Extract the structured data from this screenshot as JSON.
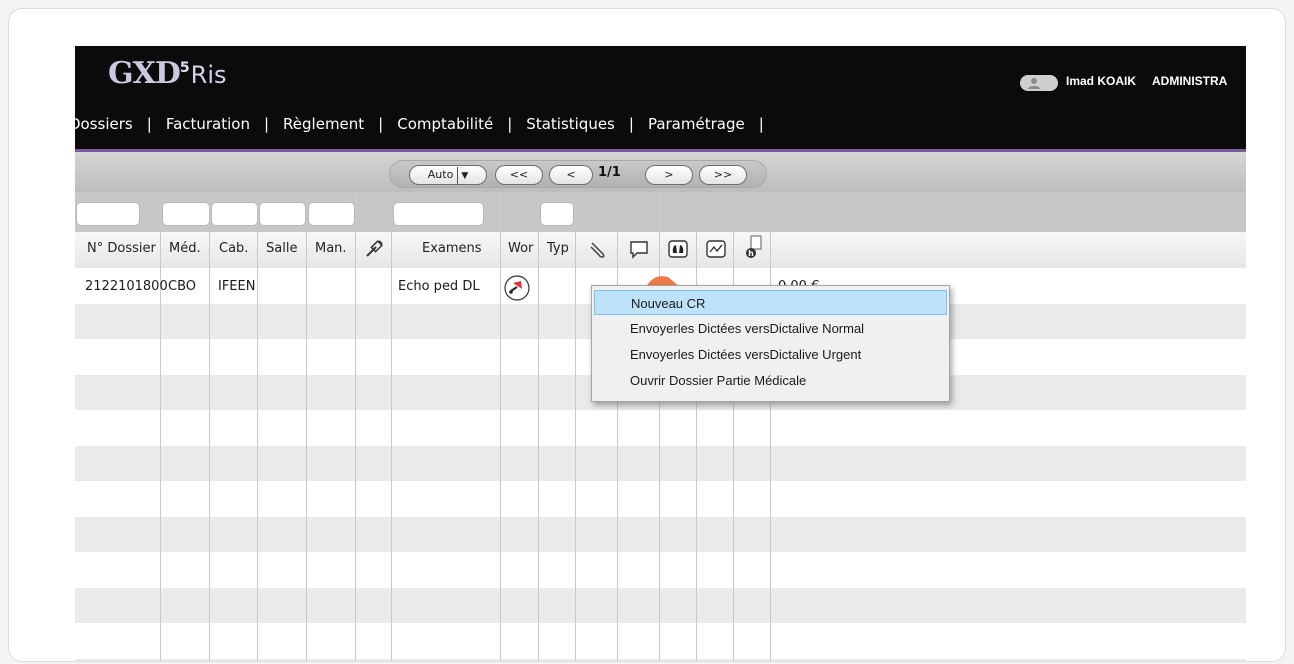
{
  "app": {
    "logo_main": "GXD",
    "logo_sup": "5",
    "logo_suffix": "Ris",
    "user_name": "Imad KOAIK",
    "user_role": "ADMINISTRA"
  },
  "nav": {
    "items": [
      {
        "label": "Dossiers"
      },
      {
        "label": "Facturation"
      },
      {
        "label": "Règlement"
      },
      {
        "label": "Comptabilité"
      },
      {
        "label": "Statistiques"
      },
      {
        "label": "Paramétrage"
      }
    ],
    "separator": "|"
  },
  "pager": {
    "mode": "Auto",
    "first": "<<",
    "prev": "<",
    "page_info": "1/1",
    "next": ">",
    "last": ">>"
  },
  "columns": {
    "dossier": "N° Dossier",
    "med": "Méd.",
    "cab": "Cab.",
    "salle": "Salle",
    "man": "Man.",
    "examens": "Examens",
    "wor": "Wor",
    "typ": "Typ"
  },
  "icons": [
    "syringe-icon",
    "paperclip-icon",
    "comment-icon",
    "lungs-icon",
    "chart-icon",
    "document-h-icon"
  ],
  "row": {
    "dossier": "2122101800",
    "med": "CBO",
    "cab": "IFEEN",
    "examens": "Echo ped DL",
    "amount_partial": "0,00 €"
  },
  "context_menu": {
    "items": [
      {
        "label": "Nouveau CR",
        "highlighted": true
      },
      {
        "label": "Envoyerles Dictées versDictalive Normal"
      },
      {
        "label": "Envoyerles Dictées versDictalive Urgent"
      },
      {
        "label": "Ouvrir Dossier Partie Médicale"
      }
    ]
  },
  "colors": {
    "header_bg": "#0b0b0b",
    "accent_purple": "#7a5c9c",
    "menu_highlight": "#bfe2fb"
  }
}
